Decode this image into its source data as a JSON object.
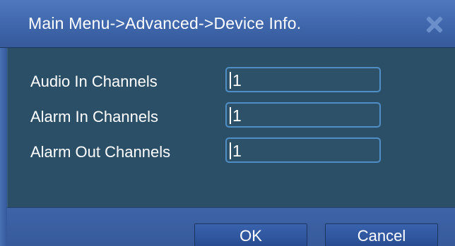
{
  "window": {
    "title": "Main Menu->Advanced->Device Info.",
    "close_icon": "close-icon"
  },
  "fields": [
    {
      "label": "Audio In Channels",
      "value": "1"
    },
    {
      "label": "Alarm In Channels",
      "value": "1"
    },
    {
      "label": "Alarm Out Channels",
      "value": "1"
    }
  ],
  "buttons": {
    "ok_label": "OK",
    "cancel_label": "Cancel"
  },
  "colors": {
    "title_bar": "#3f66ab",
    "panel_bg": "#2c4f68",
    "field_border": "#4f8fc6",
    "button_bg": "#2f569e",
    "close_icon": "#6a8fcb"
  }
}
